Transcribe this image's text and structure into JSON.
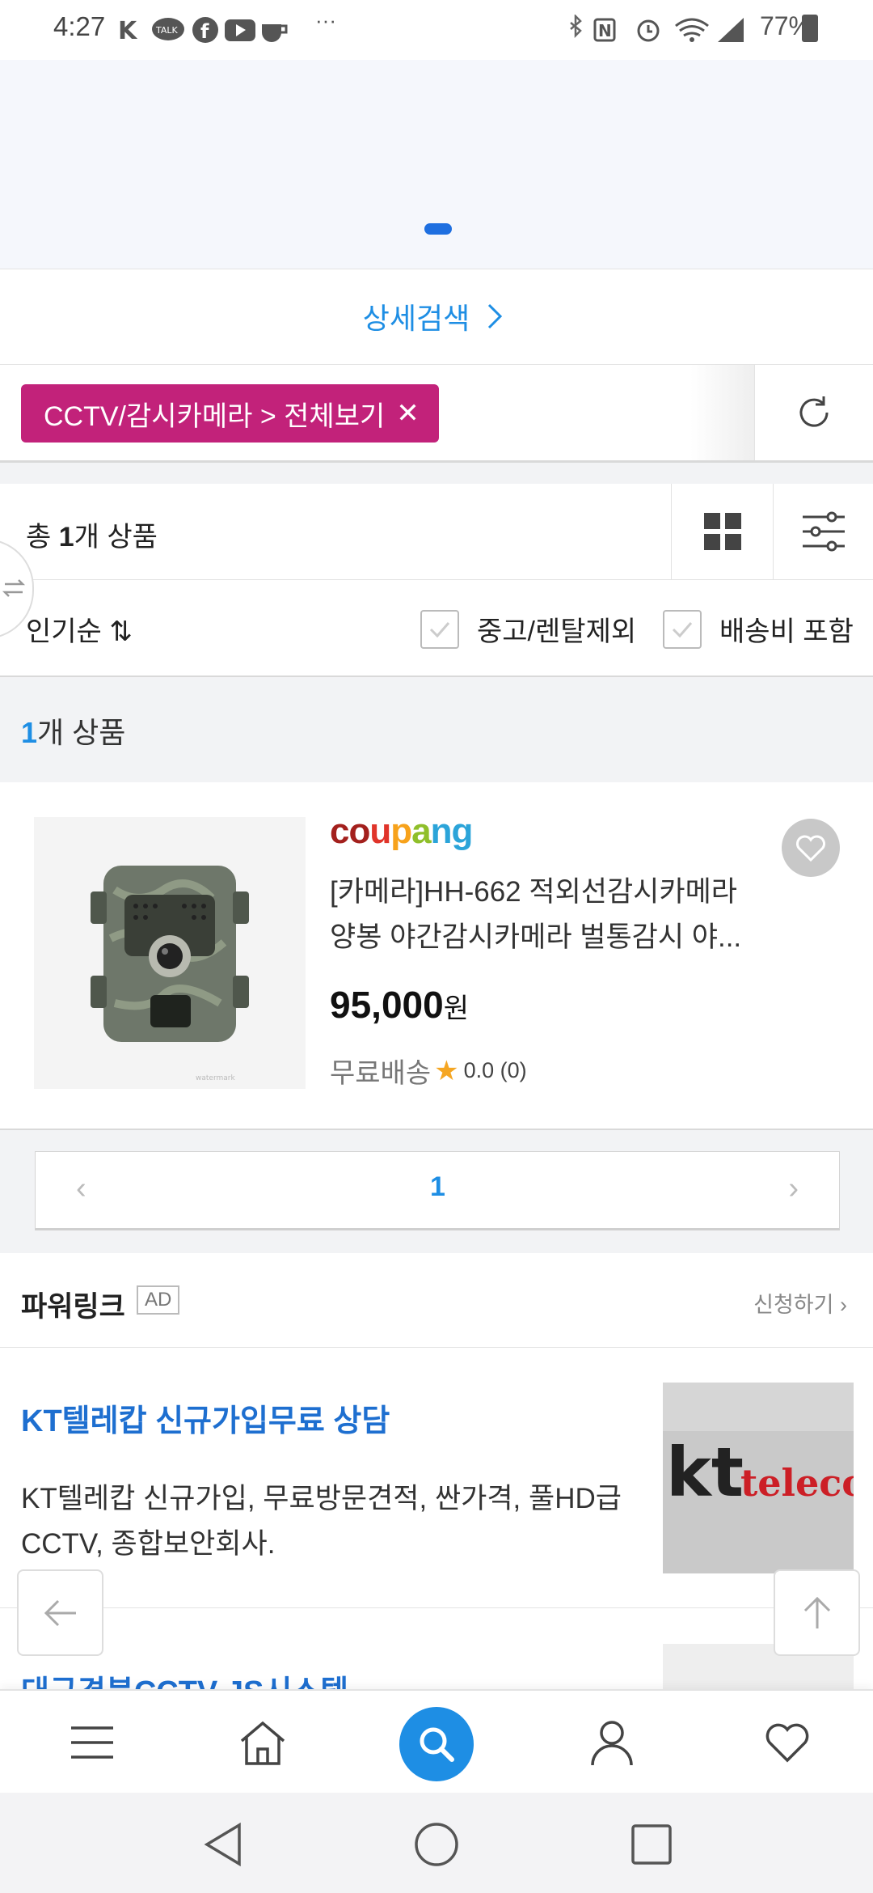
{
  "status_bar": {
    "time": "4:27",
    "battery": "77%",
    "notification_icons": [
      "kakaotalk-talk",
      "facebook",
      "youtube",
      "coffee",
      "more"
    ],
    "system_icons": [
      "bluetooth",
      "nfc",
      "alarm",
      "wifi",
      "signal",
      "battery"
    ]
  },
  "detail_search": {
    "label": "상세검색"
  },
  "filter": {
    "chip_label": "CCTV/감시카메라 > 전체보기"
  },
  "results": {
    "count_prefix": "총 ",
    "count_number": "1",
    "count_suffix": "개 상품"
  },
  "sort": {
    "label": "인기순",
    "exclude_used": "중고/렌탈제외",
    "include_shipping": "배송비 포함"
  },
  "products_header": {
    "number": "1",
    "suffix": "개 상품"
  },
  "product": {
    "brand": "coupang",
    "name": "[카메라]HH-662 적외선감시카메라 양봉 야간감시카메라 벌통감시 야...",
    "price": "95,000",
    "currency": "원",
    "shipping": "무료배송",
    "rating": "0.0 (0)"
  },
  "pagination": {
    "current": "1"
  },
  "powerlink": {
    "title": "파워링크",
    "ad_badge": "AD",
    "apply": "신청하기"
  },
  "ads": [
    {
      "title": "KT텔레캅 신규가입무료 상담",
      "description": "KT텔레캅 신규가입, 무료방문견적, 싼가격, 풀HD급 CCTV, 종합보안회사.",
      "image_text_kt": "kt",
      "image_text_telecop": "telecop"
    },
    {
      "title": "대구경북CCTV JS시스템"
    }
  ],
  "colors": {
    "accent": "#1e8ee4",
    "chip": "#c2227a",
    "ad_title": "#1e6fd0"
  }
}
